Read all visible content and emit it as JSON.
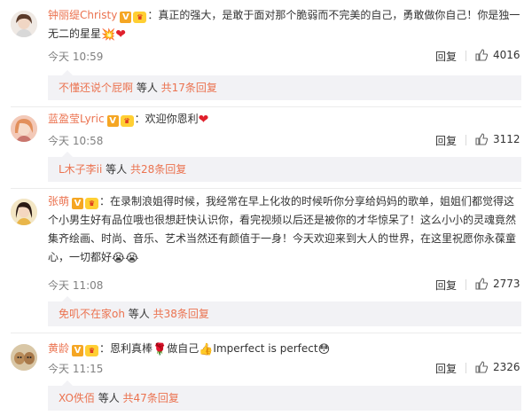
{
  "comments": [
    {
      "username": "钟丽缇Christy",
      "badge": "V",
      "content": "：真正的强大，是敢于面对那个脆弱而不完美的自己，勇敢做你自己！你是独一无二的星星",
      "time": "今天 10:59",
      "reply_label": "回复",
      "likes": "4016",
      "sub_user": "不懂还说个屁啊",
      "sub_mid": " 等人 ",
      "sub_count": "共17条回复"
    },
    {
      "username": "蓝盈莹Lyric",
      "badge": "V",
      "content": "：欢迎你恩利",
      "time": "今天 10:58",
      "reply_label": "回复",
      "likes": "3112",
      "sub_user": "L木子李ii",
      "sub_mid": " 等人 ",
      "sub_count": "共28条回复"
    },
    {
      "username": "张萌",
      "badge": "V",
      "content": "：在录制浪姐得时候，我经常在早上化妆的时候听你分享给妈妈的歌单，姐姐们都觉得这个小男生好有品位哦也很想赶快认识你，看完视频以后还是被你的才华惊呆了！这么小小的灵魂竟然集齐绘画、时尚、音乐、艺术当然还有颜值于一身！今天欢迎来到大人的世界，在这里祝愿你永葆童心，一切都好",
      "time": "今天 11:08",
      "reply_label": "回复",
      "likes": "2773",
      "sub_user": "免叽不在家oh",
      "sub_mid": " 等人 ",
      "sub_count": "共38条回复"
    },
    {
      "username": "黄龄",
      "badge": "V",
      "content_a": "：恩利真棒",
      "content_b": "做自己",
      "content_c": "Imperfect is perfect",
      "time": "今天 11:15",
      "reply_label": "回复",
      "likes": "2326",
      "sub_user": "XO佚佰",
      "sub_mid": " 等人 ",
      "sub_count": "共47条回复"
    }
  ],
  "colors": {
    "username": "#eb7350",
    "sub_bg": "#f2f2f5",
    "heart": "#e0202c"
  },
  "icons": [
    "crown-icon",
    "heart-icon",
    "star-burst-icon",
    "thumbs-up-icon",
    "rose-icon",
    "face-icon"
  ]
}
